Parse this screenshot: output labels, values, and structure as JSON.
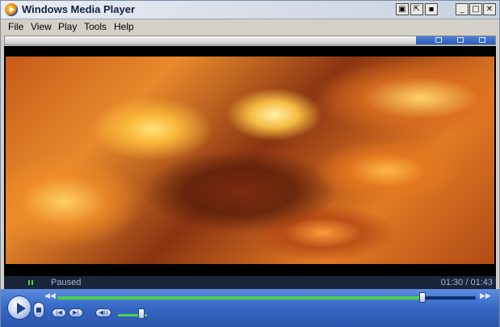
{
  "window": {
    "title": "Windows Media Player",
    "title_buttons": [
      {
        "name": "fullscreen-mode-button",
        "glyph": "▣"
      },
      {
        "name": "skin-mode-button",
        "glyph": "⇱"
      },
      {
        "name": "mini-mode-button",
        "glyph": "▪"
      },
      {
        "name": "minimize-button",
        "glyph": "_"
      },
      {
        "name": "maximize-button",
        "glyph": "□"
      },
      {
        "name": "close-button",
        "glyph": "✕"
      }
    ]
  },
  "menu": {
    "file": "File",
    "view": "View",
    "play": "Play",
    "tools": "Tools",
    "help": "Help"
  },
  "status": {
    "state": "Paused",
    "time": "01:30 / 01:43"
  },
  "playback": {
    "position_fraction": 0.873,
    "volume_fraction": 0.8
  },
  "colors": {
    "accent": "#3567c4",
    "progress": "#4bd24b"
  },
  "controls": {
    "prev_glyph": "|◀",
    "next_glyph": "▶|",
    "mute_glyph": "◀))",
    "seek_back_glyph": "◀◀",
    "seek_fwd_glyph": "▶▶"
  }
}
